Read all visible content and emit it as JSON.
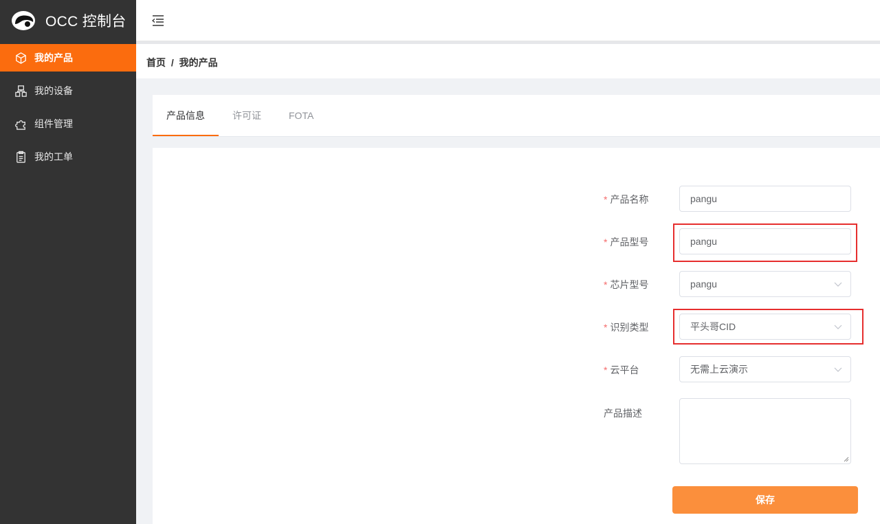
{
  "app": {
    "title": "OCC 控制台"
  },
  "sidebar": {
    "items": [
      {
        "label": "我的产品",
        "icon": "cube-icon",
        "active": true
      },
      {
        "label": "我的设备",
        "icon": "devices-icon",
        "active": false
      },
      {
        "label": "组件管理",
        "icon": "puzzle-icon",
        "active": false
      },
      {
        "label": "我的工单",
        "icon": "clipboard-icon",
        "active": false
      }
    ]
  },
  "breadcrumb": {
    "home": "首页",
    "separator": "/",
    "current": "我的产品"
  },
  "tabs": [
    {
      "label": "产品信息",
      "active": true
    },
    {
      "label": "许可证",
      "active": false
    },
    {
      "label": "FOTA",
      "active": false
    }
  ],
  "form": {
    "product_name": {
      "label": "产品名称",
      "required": true,
      "value": "pangu"
    },
    "product_model": {
      "label": "产品型号",
      "required": true,
      "value": "pangu"
    },
    "chip_model": {
      "label": "芯片型号",
      "required": true,
      "value": "pangu"
    },
    "id_type": {
      "label": "识别类型",
      "required": true,
      "value": "平头哥CID"
    },
    "cloud_platform": {
      "label": "云平台",
      "required": true,
      "value": "无需上云演示"
    },
    "description": {
      "label": "产品描述",
      "required": false,
      "value": ""
    },
    "required_mark": "*",
    "save_label": "保存"
  },
  "colors": {
    "accent": "#fb6c0e",
    "sidebar_bg": "#333333",
    "save_button": "#fb8f3c",
    "highlight": "#e62d2d"
  }
}
